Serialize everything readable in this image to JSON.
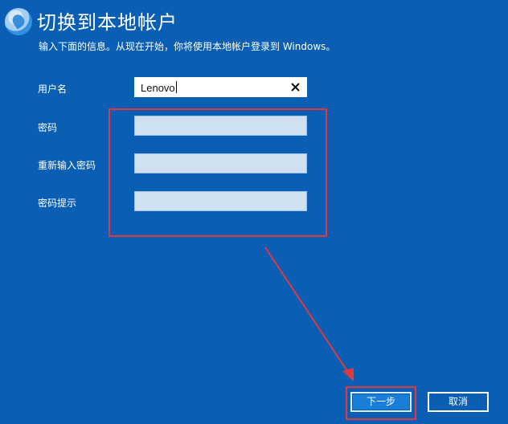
{
  "window": {
    "title": "切换到本地帐户",
    "subtitle": "输入下面的信息。从现在开始，你将使用本地帐户登录到 Windows。"
  },
  "form": {
    "username_label": "用户名",
    "username_value": "Lenovo",
    "password_label": "密码",
    "password_value": "",
    "reenter_label": "重新输入密码",
    "reenter_value": "",
    "hint_label": "密码提示",
    "hint_value": ""
  },
  "buttons": {
    "next_label": "下一步",
    "cancel_label": "取消"
  },
  "icons": {
    "clear": "close-icon",
    "watermark": "watermark-logo-icon"
  },
  "colors": {
    "background": "#0a5fb4",
    "highlight": "#e0393f",
    "field_inactive": "#cfe0f0"
  }
}
